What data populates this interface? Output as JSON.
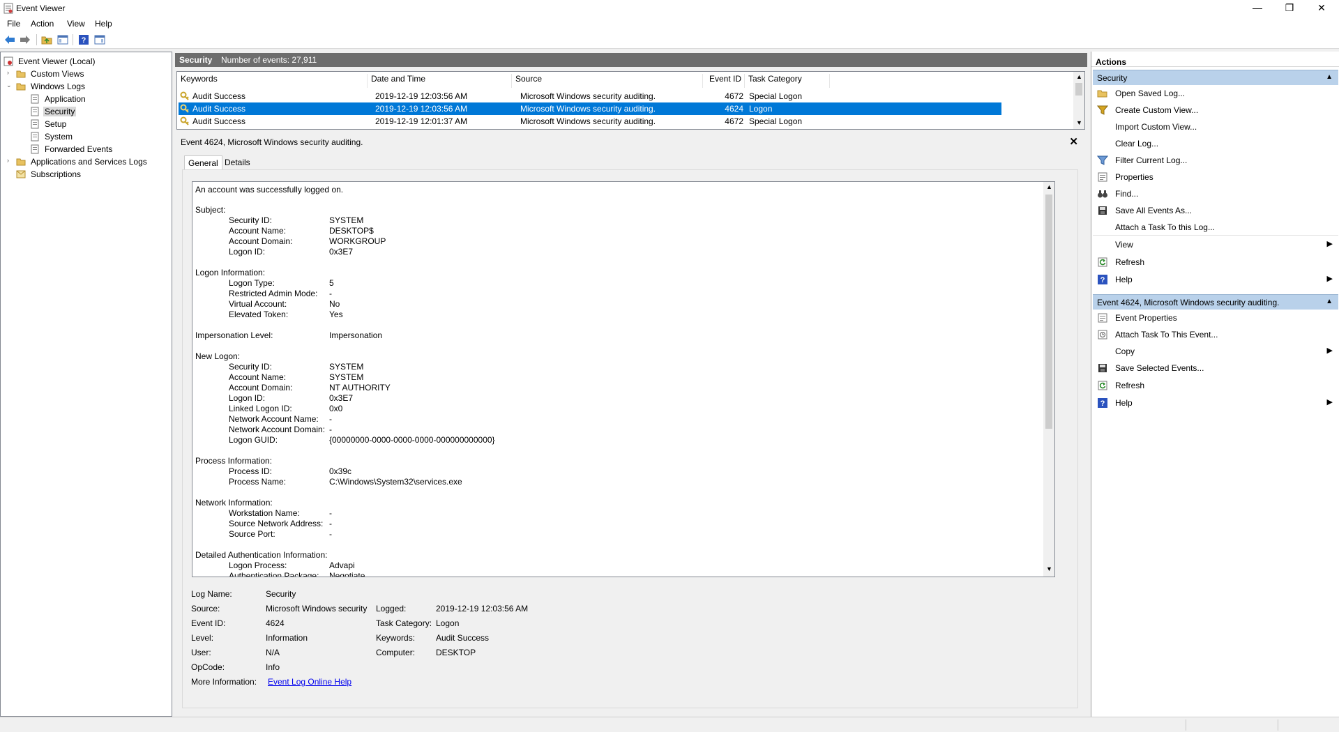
{
  "window": {
    "title": "Event Viewer",
    "minimize_glyph": "—",
    "restore_glyph": "❐",
    "close_glyph": "✕"
  },
  "menubar": [
    "File",
    "Action",
    "View",
    "Help"
  ],
  "toolbar": {
    "icons": [
      "back-arrow-icon",
      "forward-arrow-icon",
      "up-folder-icon",
      "show-hide-tree-icon",
      "help-icon",
      "show-hide-action-pane-icon"
    ]
  },
  "tree": {
    "root": "Event Viewer (Local)",
    "custom_views": "Custom Views",
    "windows_logs": "Windows Logs",
    "application": "Application",
    "security": "Security",
    "setup": "Setup",
    "system": "System",
    "forwarded": "Forwarded Events",
    "apps_services": "Applications and Services Logs",
    "subscriptions": "Subscriptions"
  },
  "center": {
    "log_name": "Security",
    "event_count": "Number of events: 27,911"
  },
  "list": {
    "columns": [
      "Keywords",
      "Date and Time",
      "Source",
      "Event ID",
      "Task Category"
    ],
    "rows": [
      {
        "keywords": "Audit Success",
        "date": "2019-12-19 12:03:56 AM",
        "source": "Microsoft Windows security auditing.",
        "event_id": "4672",
        "category": "Special Logon"
      },
      {
        "keywords": "Audit Success",
        "date": "2019-12-19 12:03:56 AM",
        "source": "Microsoft Windows security auditing.",
        "event_id": "4624",
        "category": "Logon"
      },
      {
        "keywords": "Audit Success",
        "date": "2019-12-19 12:01:37 AM",
        "source": "Microsoft Windows security auditing.",
        "event_id": "4672",
        "category": "Special Logon"
      }
    ]
  },
  "detail": {
    "header": "Event 4624, Microsoft Windows security auditing.",
    "close_glyph": "✕",
    "tabs": [
      "General",
      "Details"
    ],
    "description": {
      "intro": "An account was successfully logged on.",
      "subject_header": "Subject:",
      "subject": [
        {
          "label": "Security ID:",
          "value": "SYSTEM"
        },
        {
          "label": "Account Name:",
          "value": "DESKTOP$"
        },
        {
          "label": "Account Domain:",
          "value": "WORKGROUP"
        },
        {
          "label": "Logon ID:",
          "value": "0x3E7"
        }
      ],
      "logon_info_header": "Logon Information:",
      "logon_info": [
        {
          "label": "Logon Type:",
          "value": "5"
        },
        {
          "label": "Restricted Admin Mode:",
          "value": "-"
        },
        {
          "label": "Virtual Account:",
          "value": "No"
        },
        {
          "label": "Elevated Token:",
          "value": "Yes"
        }
      ],
      "impersonation_label": "Impersonation Level:",
      "impersonation_value": "Impersonation",
      "new_logon_header": "New Logon:",
      "new_logon": [
        {
          "label": "Security ID:",
          "value": "SYSTEM"
        },
        {
          "label": "Account Name:",
          "value": "SYSTEM"
        },
        {
          "label": "Account Domain:",
          "value": "NT AUTHORITY"
        },
        {
          "label": "Logon ID:",
          "value": "0x3E7"
        },
        {
          "label": "Linked Logon ID:",
          "value": "0x0"
        },
        {
          "label": "Network Account Name:",
          "value": "-"
        },
        {
          "label": "Network Account Domain:",
          "value": "-"
        },
        {
          "label": "Logon GUID:",
          "value": "{00000000-0000-0000-0000-000000000000}"
        }
      ],
      "process_header": "Process Information:",
      "process": [
        {
          "label": "Process ID:",
          "value": "0x39c"
        },
        {
          "label": "Process Name:",
          "value": "C:\\Windows\\System32\\services.exe"
        }
      ],
      "network_header": "Network Information:",
      "network": [
        {
          "label": "Workstation Name:",
          "value": "-"
        },
        {
          "label": "Source Network Address:",
          "value": "-"
        },
        {
          "label": "Source Port:",
          "value": "-"
        }
      ],
      "auth_header": "Detailed Authentication Information:",
      "auth": [
        {
          "label": "Logon Process:",
          "value": "Advapi"
        },
        {
          "label": "Authentication Package:",
          "value": "Negotiate"
        }
      ]
    },
    "meta": {
      "log_name_label": "Log Name:",
      "log_name": "Security",
      "source_label": "Source:",
      "source": "Microsoft Windows security",
      "logged_label": "Logged:",
      "logged": "2019-12-19 12:03:56 AM",
      "event_id_label": "Event ID:",
      "event_id": "4624",
      "task_cat_label": "Task Category:",
      "task_cat": "Logon",
      "level_label": "Level:",
      "level": "Information",
      "keywords_label": "Keywords:",
      "keywords": "Audit Success",
      "user_label": "User:",
      "user": "N/A",
      "computer_label": "Computer:",
      "computer": "DESKTOP",
      "opcode_label": "OpCode:",
      "opcode": "Info",
      "more_info_label": "More Information:",
      "more_info_link": "Event Log Online Help"
    }
  },
  "actions": {
    "title": "Actions",
    "section1": "Security",
    "section1_items": [
      {
        "label": "Open Saved Log...",
        "icon": "open-folder-icon"
      },
      {
        "label": "Create Custom View...",
        "icon": "filter-icon"
      },
      {
        "label": "Import Custom View...",
        "icon": ""
      },
      {
        "label": "Clear Log...",
        "icon": ""
      },
      {
        "label": "Filter Current Log...",
        "icon": "filter-icon"
      },
      {
        "label": "Properties",
        "icon": "properties-icon"
      },
      {
        "label": "Find...",
        "icon": "binoculars-icon"
      },
      {
        "label": "Save All Events As...",
        "icon": "save-icon"
      },
      {
        "label": "Attach a Task To this Log...",
        "icon": ""
      },
      {
        "label": "View",
        "icon": "",
        "submenu": true
      },
      {
        "label": "Refresh",
        "icon": "refresh-icon"
      },
      {
        "label": "Help",
        "icon": "help-icon",
        "submenu": true
      }
    ],
    "section2": "Event 4624, Microsoft Windows security auditing.",
    "section2_items": [
      {
        "label": "Event Properties",
        "icon": "properties-icon"
      },
      {
        "label": "Attach Task To This Event...",
        "icon": "task-icon"
      },
      {
        "label": "Copy",
        "icon": "",
        "submenu": true
      },
      {
        "label": "Save Selected Events...",
        "icon": "save-icon"
      },
      {
        "label": "Refresh",
        "icon": "refresh-icon"
      },
      {
        "label": "Help",
        "icon": "help-icon",
        "submenu": true
      }
    ],
    "collapse_glyph": "▲",
    "submenu_glyph": "▶"
  },
  "colors": {
    "selection": "#0078d7",
    "section_header": "#b9d1ea",
    "pane_header": "#6d6d6d",
    "link": "#0000ee"
  }
}
